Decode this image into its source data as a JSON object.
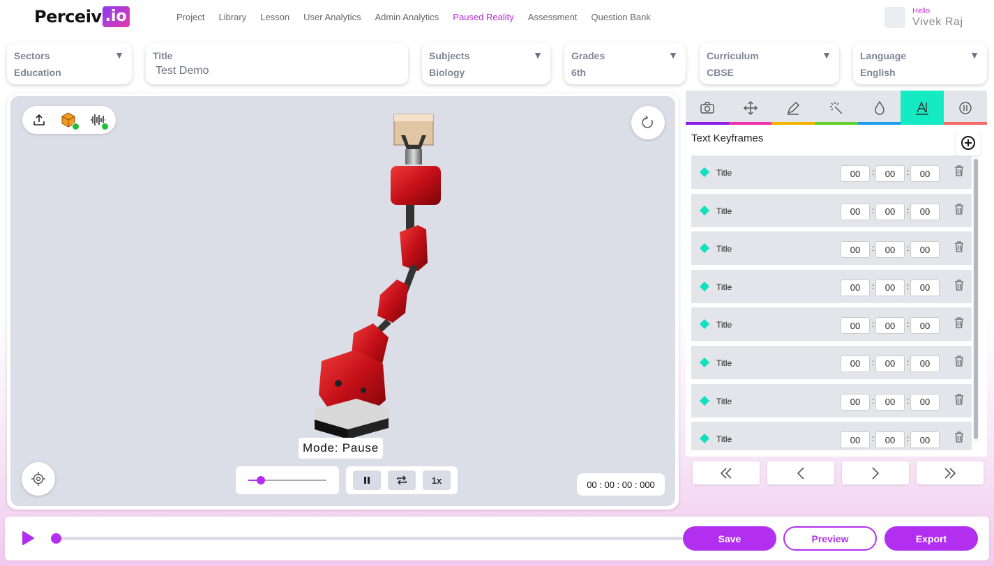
{
  "app": {
    "logo_main": "Perceiv",
    "logo_accent": ".io"
  },
  "nav": {
    "items": [
      "Project",
      "Library",
      "Lesson",
      "User Analytics",
      "Admin Analytics",
      "Paused Reality",
      "Assessment",
      "Question Bank"
    ],
    "active": "Paused Reality"
  },
  "user": {
    "greeting": "Hello",
    "name": "Vivek Raj"
  },
  "filters": {
    "sectors": {
      "label": "Sectors",
      "value": "Education"
    },
    "title": {
      "label": "Title",
      "value": "Test Demo"
    },
    "subjects": {
      "label": "Subjects",
      "value": "Biology"
    },
    "grades": {
      "label": "Grades",
      "value": "6th"
    },
    "curriculum": {
      "label": "Curriculum",
      "value": "CBSE"
    },
    "language": {
      "label": "Language",
      "value": "English"
    },
    "dropdown_glyph": "▼"
  },
  "viewport": {
    "mode_text": "Mode: Pause",
    "speed_label": "1x",
    "timecode": "00 : 00 : 00 : 000",
    "speed_slider_fraction": 0.12,
    "toolbar_icons": [
      "upload-icon",
      "model-cube-icon",
      "audio-wave-icon"
    ]
  },
  "panel": {
    "tabs": [
      {
        "icon": "camera-icon",
        "color": "#8a1fe6"
      },
      {
        "icon": "move-icon",
        "color": "#ee2fae"
      },
      {
        "icon": "pen-icon",
        "color": "#f5b400"
      },
      {
        "icon": "magic-wand-icon",
        "color": "#5fd12a"
      },
      {
        "icon": "drop-icon",
        "color": "#1e9cf0"
      },
      {
        "icon": "text-icon",
        "color": "#15ebc2",
        "active": true
      },
      {
        "icon": "pause-circle-icon",
        "color": "#f26a6a"
      }
    ],
    "keyframes_title": "Text Keyframes",
    "keyframes": [
      {
        "name": "Title",
        "h": "00",
        "m": "00",
        "s": "00"
      },
      {
        "name": "Title",
        "h": "00",
        "m": "00",
        "s": "00"
      },
      {
        "name": "Title",
        "h": "00",
        "m": "00",
        "s": "00"
      },
      {
        "name": "Title",
        "h": "00",
        "m": "00",
        "s": "00"
      },
      {
        "name": "Title",
        "h": "00",
        "m": "00",
        "s": "00"
      },
      {
        "name": "Title",
        "h": "00",
        "m": "00",
        "s": "00"
      },
      {
        "name": "Title",
        "h": "00",
        "m": "00",
        "s": "00"
      },
      {
        "name": "Title",
        "h": "00",
        "m": "00",
        "s": "00"
      }
    ],
    "time_separator": ":",
    "pager_icons": [
      "first-page-icon",
      "prev-page-icon",
      "next-page-icon",
      "last-page-icon"
    ]
  },
  "bottom": {
    "timeline_progress": 0.0,
    "save": "Save",
    "preview": "Preview",
    "export": "Export"
  },
  "colors": {
    "accent": "#b22ff0",
    "active_tab": "#15ebc2",
    "robot_red": "#d1121a"
  }
}
